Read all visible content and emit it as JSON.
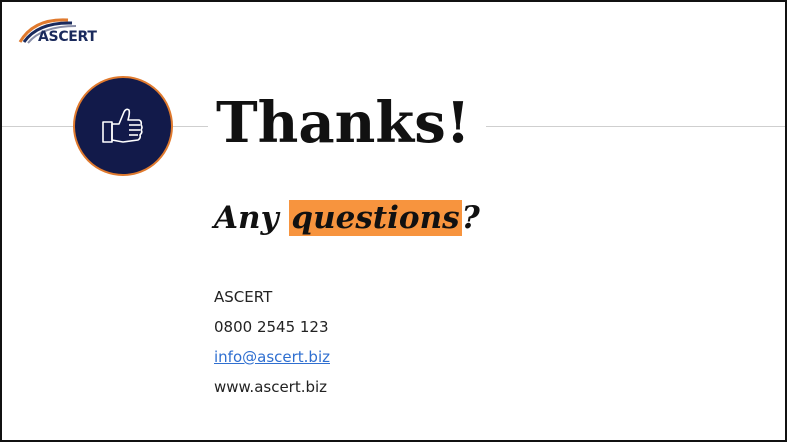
{
  "brand": {
    "logo_text": "ASCERT"
  },
  "slide": {
    "title": "Thanks!",
    "subtitle_prefix": "Any ",
    "subtitle_highlight": "questions",
    "subtitle_suffix": "?",
    "contact": {
      "company": "ASCERT",
      "phone": "0800 2545 123",
      "email": "info@ascert.biz",
      "website": "www.ascert.biz"
    },
    "badge_icon": "thumbs-up-icon"
  },
  "colors": {
    "badge_fill": "#121a4a",
    "badge_border": "#e07a2e",
    "highlight": "#f7943e",
    "link": "#2f6fd0",
    "logo_navy": "#1a2a5c"
  }
}
